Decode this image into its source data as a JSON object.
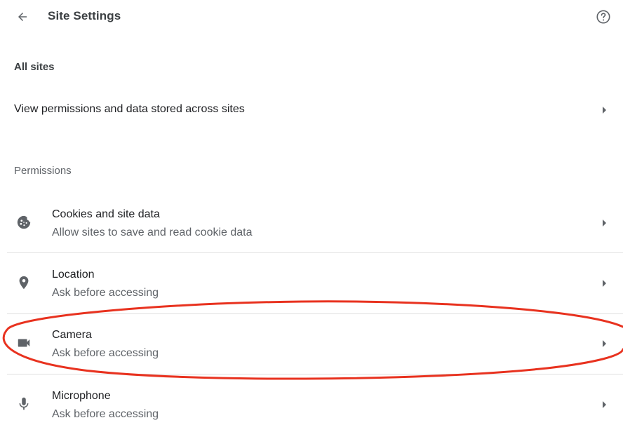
{
  "header": {
    "title": "Site Settings",
    "back_icon": "arrow-back-icon",
    "help_icon": "help-circle-icon"
  },
  "all_sites": {
    "heading": "All sites",
    "row_label": "View permissions and data stored across sites"
  },
  "permissions": {
    "heading": "Permissions",
    "items": [
      {
        "title": "Cookies and site data",
        "subtitle": "Allow sites to save and read cookie data",
        "icon": "cookie-icon"
      },
      {
        "title": "Location",
        "subtitle": "Ask before accessing",
        "icon": "location-pin-icon"
      },
      {
        "title": "Camera",
        "subtitle": "Ask before accessing",
        "icon": "video-camera-icon"
      },
      {
        "title": "Microphone",
        "subtitle": "Ask before accessing",
        "icon": "microphone-icon"
      }
    ]
  },
  "colors": {
    "annotation": "#e8321f",
    "icon": "#5f6368",
    "divider": "#e0e0e0"
  }
}
